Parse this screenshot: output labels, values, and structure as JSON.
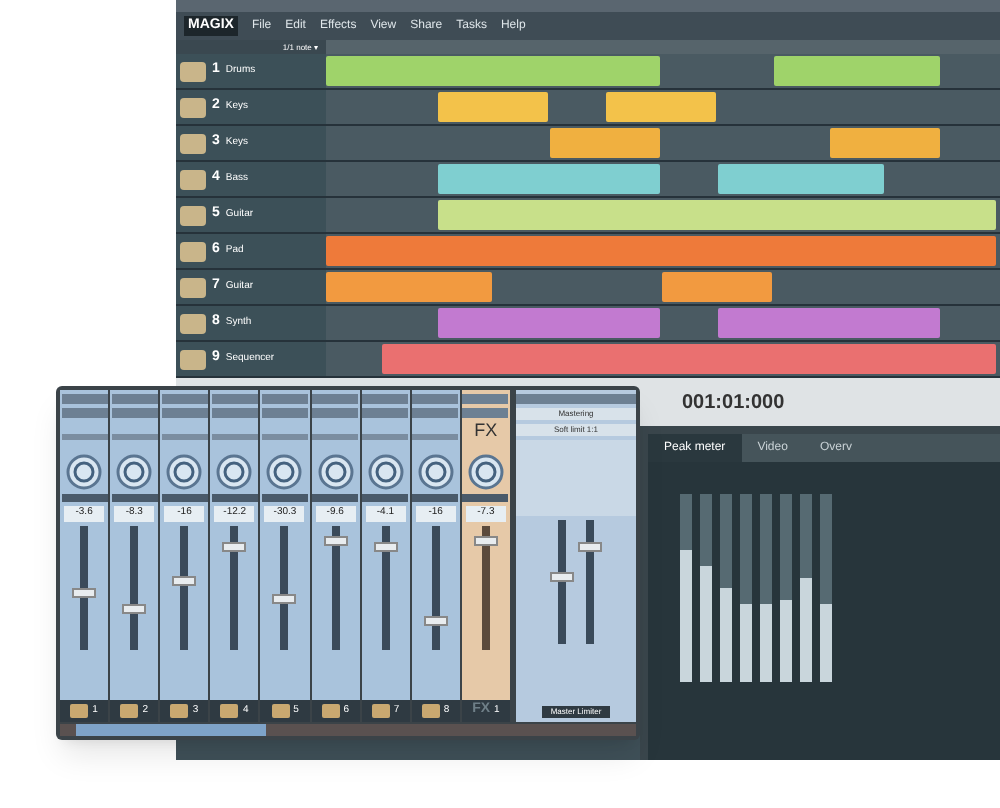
{
  "menu": {
    "logo": "MAGIX",
    "items": [
      "File",
      "Edit",
      "Effects",
      "View",
      "Share",
      "Tasks",
      "Help"
    ]
  },
  "toolbar": {
    "snap": "1/1 note ▾"
  },
  "tracks": [
    {
      "number": "1",
      "name": "Drums",
      "color": "#9fd36a"
    },
    {
      "number": "2",
      "name": "Keys",
      "color": "#f3c24a"
    },
    {
      "number": "3",
      "name": "Keys",
      "color": "#f0b040"
    },
    {
      "number": "4",
      "name": "Bass",
      "color": "#7fcfd0"
    },
    {
      "number": "5",
      "name": "Guitar",
      "color": "#c8e08a"
    },
    {
      "number": "6",
      "name": "Pad",
      "color": "#ee7a3a"
    },
    {
      "number": "7",
      "name": "Guitar",
      "color": "#f29a40"
    },
    {
      "number": "8",
      "name": "Synth",
      "color": "#c27ad0"
    },
    {
      "number": "9",
      "name": "Sequencer",
      "color": "#ea7070"
    }
  ],
  "transport": {
    "time": "001:01:000"
  },
  "panel_tabs": [
    {
      "label": "Peak meter",
      "selected": true
    },
    {
      "label": "Video",
      "selected": false
    },
    {
      "label": "Overv",
      "selected": false
    }
  ],
  "peak_meter": [
    {
      "level": 0.7
    },
    {
      "level": 0.62
    },
    {
      "level": 0.5
    },
    {
      "level": 0.42
    },
    {
      "level": 0.42
    },
    {
      "level": 0.44
    },
    {
      "level": 0.55
    },
    {
      "level": 0.42
    }
  ],
  "mixer": {
    "channels": [
      {
        "kind": "track",
        "reading": "-3.6",
        "level": 0.45,
        "number": "1"
      },
      {
        "kind": "track",
        "reading": "-8.3",
        "level": 0.3,
        "number": "2"
      },
      {
        "kind": "track",
        "reading": "-16",
        "level": 0.55,
        "number": "3"
      },
      {
        "kind": "track",
        "reading": "-12.2",
        "level": 0.85,
        "number": "4"
      },
      {
        "kind": "track",
        "reading": "-30.3",
        "level": 0.4,
        "number": "5"
      },
      {
        "kind": "track",
        "reading": "-9.6",
        "level": 0.9,
        "number": "6"
      },
      {
        "kind": "track",
        "reading": "-4.1",
        "level": 0.85,
        "number": "7"
      },
      {
        "kind": "track",
        "reading": "-16",
        "level": 0.2,
        "number": "8"
      },
      {
        "kind": "fx",
        "title": "FX",
        "reading": "-7.3",
        "level": 0.9,
        "label": "FX",
        "number": "1"
      }
    ],
    "master": {
      "presets": [
        "Mastering",
        "Soft limit 1:1"
      ],
      "footer": "Master Limiter",
      "levels": [
        {
          "level": 0.55
        },
        {
          "level": 0.8
        }
      ]
    }
  }
}
